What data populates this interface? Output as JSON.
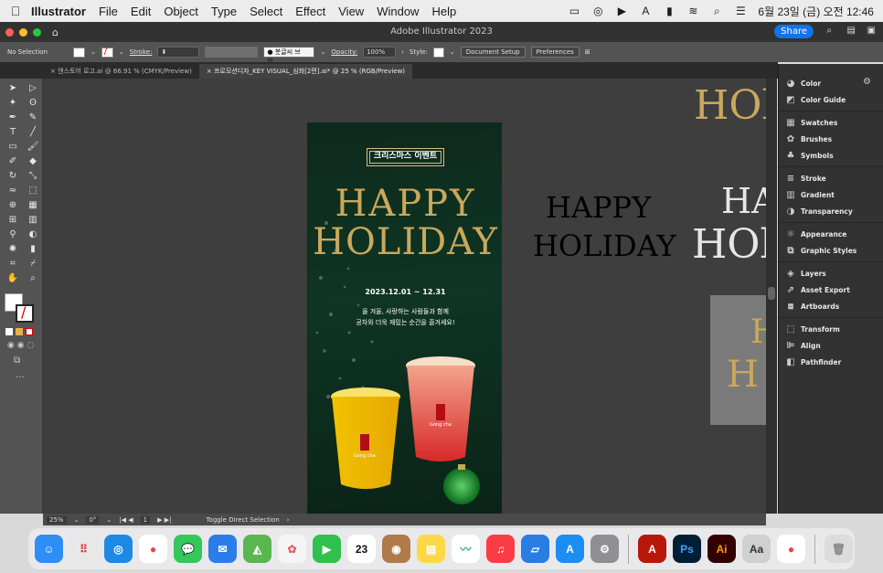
{
  "menubar": {
    "app": "Illustrator",
    "items": [
      "File",
      "Edit",
      "Object",
      "Type",
      "Select",
      "Effect",
      "View",
      "Window",
      "Help"
    ],
    "datetime": "6월 23일 (금) 오전 12:46"
  },
  "window": {
    "title": "Adobe Illustrator 2023",
    "share": "Share"
  },
  "control": {
    "selection": "No Selection",
    "stroke_label": "Stroke:",
    "brush": "● 붓글씨 브러...",
    "opacity_label": "Opacity:",
    "opacity_value": "100%",
    "style_label": "Style:",
    "doc_setup": "Document Setup",
    "preferences": "Preferences"
  },
  "tabs": [
    "× 엔스토어 로고.ai @ 66.91 % (CMYK/Preview)",
    "× 프로모션디자_KEY VISUAL_심화[2편].ai* @ 25 % (RGB/Preview)"
  ],
  "artboard": {
    "badge": "크리스마스 이벤트",
    "line1": "HAPPY",
    "line2": "HOLIDAY",
    "date": "2023.12.01 ~ 12.31",
    "desc1": "올 겨울, 사랑하는 사람들과 함께",
    "desc2": "공차와 더욱 재밌는 순간을 즐겨세요!",
    "cup_brand": "Gong cha"
  },
  "canvas_text": {
    "black1": "HAPPY",
    "black2": "HOLIDAY",
    "white1": "HA",
    "white2": "HOl",
    "top_gold": "HOl"
  },
  "panels": [
    {
      "group": [
        {
          "icon": "color-icon",
          "label": "Color"
        },
        {
          "icon": "color-guide-icon",
          "label": "Color Guide"
        }
      ]
    },
    {
      "group": [
        {
          "icon": "swatches-icon",
          "label": "Swatches"
        },
        {
          "icon": "brushes-icon",
          "label": "Brushes"
        },
        {
          "icon": "symbols-icon",
          "label": "Symbols"
        }
      ]
    },
    {
      "group": [
        {
          "icon": "stroke-icon",
          "label": "Stroke"
        },
        {
          "icon": "gradient-icon",
          "label": "Gradient"
        },
        {
          "icon": "transparency-icon",
          "label": "Transparency"
        }
      ]
    },
    {
      "group": [
        {
          "icon": "appearance-icon",
          "label": "Appearance"
        },
        {
          "icon": "graphic-styles-icon",
          "label": "Graphic Styles"
        }
      ]
    },
    {
      "group": [
        {
          "icon": "layers-icon",
          "label": "Layers"
        },
        {
          "icon": "asset-export-icon",
          "label": "Asset Export"
        },
        {
          "icon": "artboards-icon",
          "label": "Artboards"
        }
      ]
    },
    {
      "group": [
        {
          "icon": "transform-icon",
          "label": "Transform"
        },
        {
          "icon": "align-icon",
          "label": "Align"
        },
        {
          "icon": "pathfinder-icon",
          "label": "Pathfinder"
        }
      ]
    }
  ],
  "status": {
    "zoom": "25%",
    "rotate": "0°",
    "artboard": "1",
    "info": "Toggle Direct Selection"
  },
  "dock": [
    "Finder",
    "Launchpad",
    "Safari",
    "Chrome",
    "Messages",
    "Mail",
    "Maps",
    "Photos",
    "FaceTime",
    "Calendar",
    "Contacts",
    "Notes",
    "Freeform",
    "Music",
    "Keynote",
    "App Store",
    "System Settings",
    "Acrobat",
    "Photoshop",
    "Illustrator",
    "Font Book",
    "Chrome",
    "Trash"
  ],
  "calendar": {
    "month": "6월",
    "day": "23"
  }
}
